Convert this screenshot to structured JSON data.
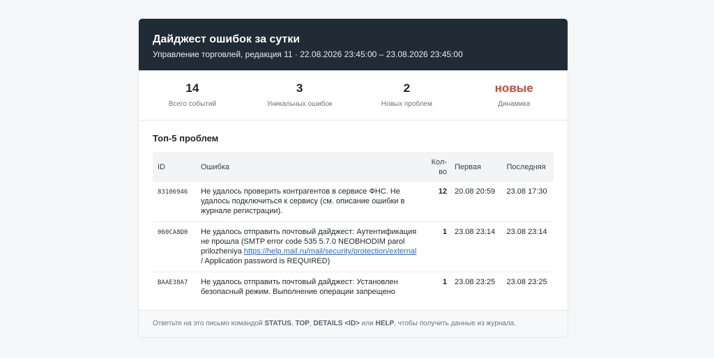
{
  "header": {
    "title": "Дайджест ошибок за сутки",
    "subtitle": "Управление торговлей, редакция 11 · 22.08.2026 23:45:00 – 23.08.2026 23:45:00"
  },
  "stats": [
    {
      "value": "14",
      "label": "Всего событий"
    },
    {
      "value": "3",
      "label": "Уникальных ошибок"
    },
    {
      "value": "2",
      "label": "Новых проблем"
    },
    {
      "value": "новые",
      "label": "Динамика",
      "color": "#d0453c"
    }
  ],
  "top": {
    "title": "Топ-5 проблем",
    "columns": {
      "id": "ID",
      "error": "Ошибка",
      "count": "Кол-во",
      "first": "Первая",
      "last": "Последняя"
    },
    "rows": [
      {
        "id": "83106946",
        "msg": "Не удалось проверить контрагентов в сервисе ФНС. Не удалось подключиться к сервису (см. описание ошибки в журнале регистрации).",
        "count": "12",
        "first": "20.08 20:59",
        "last": "23.08 17:30"
      },
      {
        "id": "060CA8D0",
        "msg_pre": "Не удалось отправить почтовый дайджест: Аутентификация не прошла (SMTP error code 535 5.7.0 NEOBHODIM parol prilozheniya ",
        "msg_link": "https://help.mail.ru/mail/security/protection/external",
        "msg_post": " / Application password is REQUIRED)",
        "count": "1",
        "first": "23.08 23:14",
        "last": "23.08 23:14"
      },
      {
        "id": "BAAE38A7",
        "msg": "Не удалось отправить почтовый дайджест: Установлен безопасный режим. Выполнение операции запрещено",
        "count": "1",
        "first": "23.08 23:25",
        "last": "23.08 23:25"
      }
    ]
  },
  "footer": {
    "t1": "Ответьте на это письмо командой ",
    "c1": "STATUS",
    "t2": ", ",
    "c2": "TOP",
    "t3": ", ",
    "c3": "DETAILS <ID>",
    "t4": " или ",
    "c4": "HELP",
    "t5": ", чтобы получить данные из журнала."
  }
}
